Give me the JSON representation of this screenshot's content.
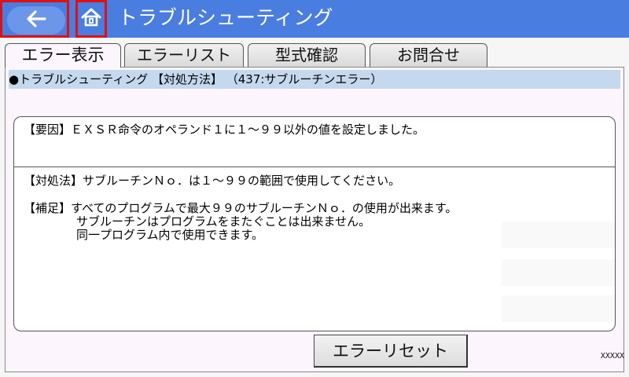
{
  "header": {
    "title": "トラブルシューティング",
    "accent_color": "#4a7de0",
    "back_icon": "arrow-left-icon",
    "home_icon": "home-icon"
  },
  "tabs": [
    {
      "label": "エラー表示",
      "active": true
    },
    {
      "label": "エラーリスト",
      "active": false
    },
    {
      "label": "型式確認",
      "active": false
    },
    {
      "label": "お問合せ",
      "active": false
    }
  ],
  "info_bar": "●トラブルシューティング 【対処方法】 （437:サブルーチンエラー）",
  "cause": "【要因】ＥＸＳＲ命令のオペランド１に１～９９以外の値を設定しました。",
  "remedy": "【対処法】サブルーチンＮｏ．は１～９９の範囲で使用してください。",
  "supplement": [
    "【補足】すべてのプログラムで最大９９のサブルーチンＮｏ．の使用が出来ます。",
    "サブルーチンはプログラムをまたぐことは出来ません。",
    "同一プログラム内で使用できます。"
  ],
  "reset_button": "エラーリセット",
  "screen_code": "XXXXX"
}
